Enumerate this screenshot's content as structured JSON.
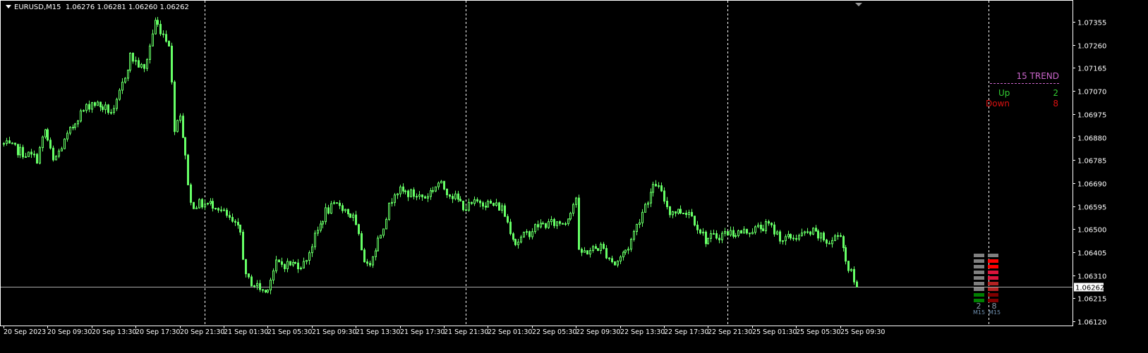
{
  "header": {
    "symbol_tf": "EURUSD,M15",
    "open": "1.06276",
    "high": "1.06281",
    "low": "1.06260",
    "close": "1.06262"
  },
  "trend_panel": {
    "title": "15 TREND",
    "up_label": "Up",
    "up_value": "2",
    "down_label": "Down",
    "down_value": "8"
  },
  "indicator": {
    "up_count": "2",
    "down_count": "8",
    "up_tf": "M15",
    "down_tf": "M15",
    "up_colors": [
      "#808080",
      "#808080",
      "#808080",
      "#808080",
      "#808080",
      "#808080",
      "#808080",
      "#008000",
      "#008000"
    ],
    "down_colors": [
      "#808080",
      "#ff0000",
      "#ff0000",
      "#dc143c",
      "#dc143c",
      "#b22222",
      "#b22222",
      "#800000",
      "#800000"
    ]
  },
  "colors": {
    "background": "#000000",
    "candle": "#66ff66",
    "axis": "#ffffff",
    "bid_line": "#aaaaaa",
    "trend_title": "#cc66cc",
    "up": "#33cc33",
    "down": "#dd1111"
  },
  "chart_data": {
    "type": "candlestick",
    "symbol": "EURUSD",
    "timeframe": "M15",
    "current_price": 1.06262,
    "ylim": [
      1.061,
      1.074
    ],
    "price_ticks": [
      1.07355,
      1.0726,
      1.07165,
      1.0707,
      1.06975,
      1.0688,
      1.06785,
      1.0669,
      1.06595,
      1.065,
      1.06405,
      1.0631,
      1.06215,
      1.0612
    ],
    "price_tick_labels": [
      "1.07355",
      "1.07260",
      "1.07165",
      "1.07070",
      "1.06975",
      "1.06880",
      "1.06785",
      "1.06690",
      "1.06595",
      "1.06500",
      "1.06405",
      "1.06310",
      "1.06215",
      "1.06120"
    ],
    "current_price_label": "1.06262",
    "bar_count": 311,
    "time_labels": [
      "20 Sep 2023",
      "20 Sep 09:30",
      "20 Sep 13:30",
      "20 Sep 17:30",
      "20 Sep 21:30",
      "21 Sep 01:30",
      "21 Sep 05:30",
      "21 Sep 09:30",
      "21 Sep 13:30",
      "21 Sep 17:30",
      "21 Sep 21:30",
      "22 Sep 01:30",
      "22 Sep 05:30",
      "22 Sep 09:30",
      "22 Sep 13:30",
      "22 Sep 17:30",
      "22 Sep 21:30",
      "25 Sep 01:30",
      "25 Sep 05:30",
      "25 Sep 09:30"
    ],
    "bars_per_label": 16,
    "day_separator_bars": [
      73,
      168,
      263,
      358
    ],
    "close_keypoints": [
      [
        0,
        1.0685
      ],
      [
        12,
        1.06791
      ],
      [
        15,
        1.06908
      ],
      [
        18,
        1.06777
      ],
      [
        27,
        1.06966
      ],
      [
        32,
        1.07024
      ],
      [
        40,
        1.0698
      ],
      [
        46,
        1.07213
      ],
      [
        51,
        1.07155
      ],
      [
        55,
        1.07358
      ],
      [
        60,
        1.07271
      ],
      [
        62,
        1.06922
      ],
      [
        64,
        1.0698
      ],
      [
        68,
        1.06603
      ],
      [
        73,
        1.06603
      ],
      [
        77,
        1.06603
      ],
      [
        86,
        1.06486
      ],
      [
        88,
        1.06298
      ],
      [
        95,
        1.0624
      ],
      [
        99,
        1.06356
      ],
      [
        109,
        1.06356
      ],
      [
        117,
        1.06574
      ],
      [
        122,
        1.06603
      ],
      [
        127,
        1.06545
      ],
      [
        132,
        1.06341
      ],
      [
        137,
        1.06486
      ],
      [
        142,
        1.06661
      ],
      [
        153,
        1.06632
      ],
      [
        158,
        1.0669
      ],
      [
        168,
        1.06588
      ],
      [
        173,
        1.06617
      ],
      [
        181,
        1.06588
      ],
      [
        186,
        1.06443
      ],
      [
        194,
        1.06516
      ],
      [
        204,
        1.0653
      ],
      [
        208,
        1.06632
      ],
      [
        209,
        1.06399
      ],
      [
        217,
        1.06428
      ],
      [
        222,
        1.06356
      ],
      [
        227,
        1.06428
      ],
      [
        233,
        1.06603
      ],
      [
        237,
        1.0669
      ],
      [
        242,
        1.06574
      ],
      [
        249,
        1.06574
      ],
      [
        255,
        1.06457
      ],
      [
        263,
        1.06486
      ],
      [
        268,
        1.06486
      ],
      [
        278,
        1.06516
      ],
      [
        283,
        1.06457
      ],
      [
        294,
        1.06486
      ],
      [
        300,
        1.06443
      ],
      [
        304,
        1.06486
      ],
      [
        306,
        1.0637
      ],
      [
        310,
        1.06262
      ]
    ]
  }
}
